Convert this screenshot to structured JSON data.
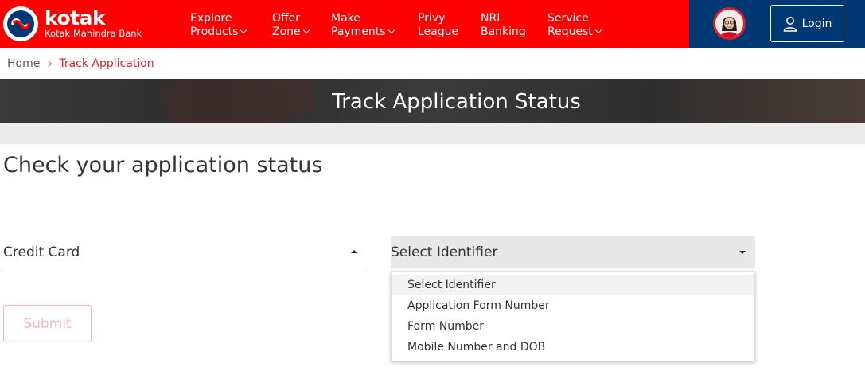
{
  "brand": {
    "name": "kotak",
    "subtitle": "Kotak Mahindra Bank",
    "colors": {
      "primary_red": "#ff0000",
      "navy": "#003874",
      "accent_red": "#e31e24"
    }
  },
  "nav": {
    "items": [
      {
        "line1": "Explore",
        "line2": "Products",
        "has_chevron": true
      },
      {
        "line1": "Offer",
        "line2": "Zone",
        "has_chevron": true
      },
      {
        "line1": "Make",
        "line2": "Payments",
        "has_chevron": true
      },
      {
        "line1": "Privy",
        "line2": "League",
        "has_chevron": false
      },
      {
        "line1": "NRI",
        "line2": "Banking",
        "has_chevron": false
      },
      {
        "line1": "Service",
        "line2": "Request",
        "has_chevron": true
      }
    ]
  },
  "header": {
    "login_label": "Login",
    "avatar_icon": "assistant-avatar-icon",
    "login_icon": "user-icon"
  },
  "breadcrumb": {
    "home": "Home",
    "current": "Track Application",
    "separator_icon": "chevron-right-icon"
  },
  "banner": {
    "title": "Track Application Status"
  },
  "form": {
    "title": "Check your application status",
    "product_select": {
      "value": "Credit Card",
      "icon": "caret-up-icon"
    },
    "identifier_select": {
      "value": "Select Identifier",
      "icon": "caret-down-icon",
      "options": [
        "Select Identifier",
        "Application Form Number",
        "Form Number",
        "Mobile Number and DOB"
      ]
    },
    "submit_label": "Submit"
  }
}
